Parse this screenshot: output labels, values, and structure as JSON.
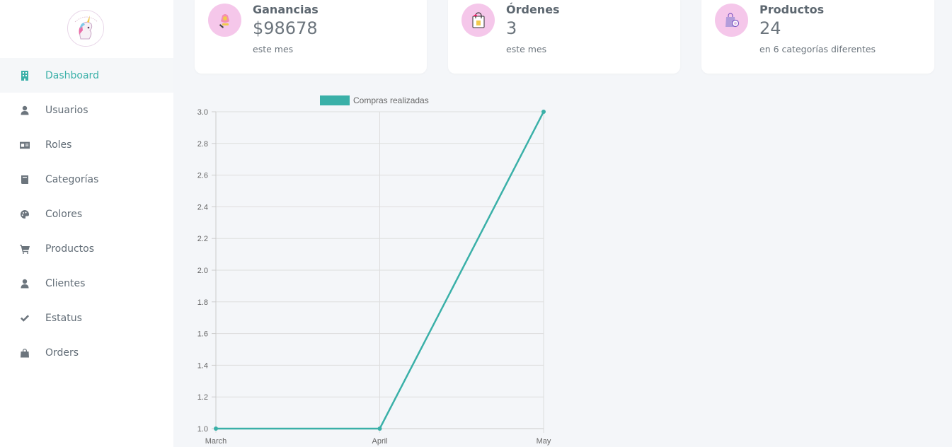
{
  "sidebar": {
    "logo_name": "unicorn-logo",
    "items": [
      {
        "label": "Dashboard",
        "icon": "building-icon",
        "active": true
      },
      {
        "label": "Usuarios",
        "icon": "user-icon"
      },
      {
        "label": "Roles",
        "icon": "id-card-icon"
      },
      {
        "label": "Categorías",
        "icon": "book-icon"
      },
      {
        "label": "Colores",
        "icon": "palette-icon"
      },
      {
        "label": "Productos",
        "icon": "cart-icon"
      },
      {
        "label": "Clientes",
        "icon": "user-icon"
      },
      {
        "label": "Estatus",
        "icon": "check-icon"
      },
      {
        "label": "Orders",
        "icon": "bag-icon"
      }
    ]
  },
  "cards": [
    {
      "title": "Ganancias",
      "value": "$98678",
      "sub": "este mes",
      "icon": "money-icon"
    },
    {
      "title": "Órdenes",
      "value": "3",
      "sub": "este mes",
      "icon": "shopping-bag-icon"
    },
    {
      "title": "Productos",
      "value": "24",
      "sub": "en 6 categorías diferentes",
      "icon": "product-bag-icon"
    }
  ],
  "colors": {
    "accent": "#3ab0a8",
    "icon_bg": "#f5c7ea",
    "background": "#f4f6f9"
  },
  "chart_data": {
    "type": "line",
    "categories": [
      "March",
      "April",
      "May"
    ],
    "series": [
      {
        "name": "Compras realizadas",
        "values": [
          1,
          1,
          3
        ]
      }
    ],
    "ylim": [
      1.0,
      3.0
    ],
    "yticks": [
      "3.0",
      "2.8",
      "2.6",
      "2.4",
      "2.2",
      "2.0",
      "1.8",
      "1.6",
      "1.4",
      "1.2",
      "1.0"
    ],
    "grid": true,
    "legend": "top",
    "color": "#3ab0a8"
  }
}
